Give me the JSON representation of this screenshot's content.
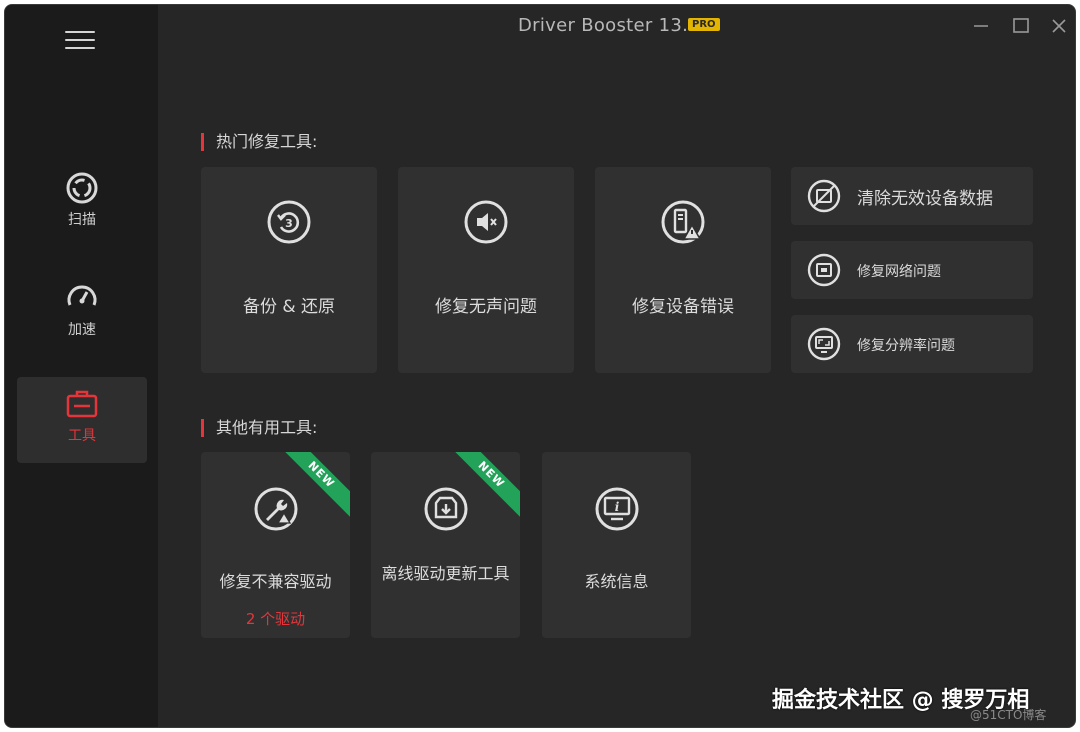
{
  "window": {
    "title": "Driver Booster 13.1",
    "badge": "PRO"
  },
  "sidebar": {
    "items": [
      {
        "label": "扫描",
        "icon": "scan-icon"
      },
      {
        "label": "加速",
        "icon": "speedometer-icon"
      },
      {
        "label": "工具",
        "icon": "toolbox-icon",
        "active": true
      }
    ]
  },
  "sections": {
    "popular_title": "热门修复工具:",
    "other_title": "其他有用工具:"
  },
  "popular_tools": [
    {
      "label": "备份 & 还原",
      "icon": "backup-restore-icon"
    },
    {
      "label": "修复无声问题",
      "icon": "mute-speaker-icon"
    },
    {
      "label": "修复设备错误",
      "icon": "device-warning-icon"
    }
  ],
  "side_tools": [
    {
      "label": "清除无效设备数据",
      "icon": "clean-device-data-icon"
    },
    {
      "label": "修复网络问题",
      "icon": "network-icon"
    },
    {
      "label": "修复分辨率问题",
      "icon": "resolution-icon"
    }
  ],
  "other_tools": [
    {
      "label": "修复不兼容驱动",
      "sub": "2 个驱动",
      "icon": "wrench-warning-icon",
      "ribbon": "NEW"
    },
    {
      "label": "离线驱动更新工具",
      "icon": "offline-download-icon",
      "ribbon": "NEW"
    },
    {
      "label": "系统信息",
      "icon": "system-info-icon"
    }
  ],
  "colors": {
    "accent": "#e5353b",
    "background": "#262626",
    "sidebar": "#1b1b1b",
    "card": "#303030",
    "ribbon": "#23a35a"
  },
  "watermark": {
    "main": "掘金技术社区 @ 搜罗万相",
    "sub": "@51CTO博客"
  }
}
